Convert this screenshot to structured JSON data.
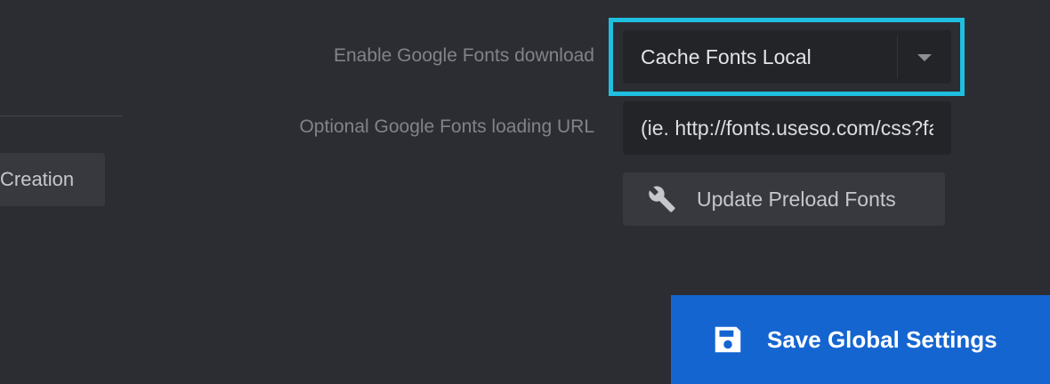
{
  "left_panel": {
    "creation_button_label": "Creation"
  },
  "fonts": {
    "download_label": "Enable Google Fonts download",
    "download_selected": "Cache Fonts Local",
    "url_label": "Optional Google Fonts loading URL",
    "url_placeholder": "(ie. http://fonts.useso.com/css?family",
    "preload_button_label": "Update Preload Fonts",
    "preload_icon": "wrench-icon",
    "highlight_color": "#1fbfe0"
  },
  "footer": {
    "save_button_label": "Save Global Settings",
    "save_icon": "floppy-disk-icon",
    "save_color": "#1565d0"
  }
}
